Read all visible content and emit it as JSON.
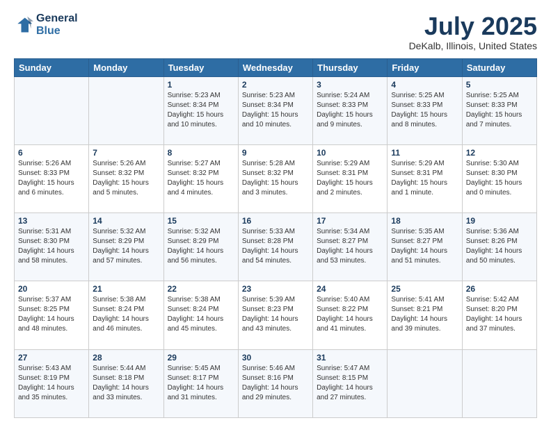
{
  "logo": {
    "line1": "General",
    "line2": "Blue"
  },
  "title": "July 2025",
  "subtitle": "DeKalb, Illinois, United States",
  "days_header": [
    "Sunday",
    "Monday",
    "Tuesday",
    "Wednesday",
    "Thursday",
    "Friday",
    "Saturday"
  ],
  "weeks": [
    [
      {
        "day": "",
        "info": ""
      },
      {
        "day": "",
        "info": ""
      },
      {
        "day": "1",
        "info": "Sunrise: 5:23 AM\nSunset: 8:34 PM\nDaylight: 15 hours and 10 minutes."
      },
      {
        "day": "2",
        "info": "Sunrise: 5:23 AM\nSunset: 8:34 PM\nDaylight: 15 hours and 10 minutes."
      },
      {
        "day": "3",
        "info": "Sunrise: 5:24 AM\nSunset: 8:33 PM\nDaylight: 15 hours and 9 minutes."
      },
      {
        "day": "4",
        "info": "Sunrise: 5:25 AM\nSunset: 8:33 PM\nDaylight: 15 hours and 8 minutes."
      },
      {
        "day": "5",
        "info": "Sunrise: 5:25 AM\nSunset: 8:33 PM\nDaylight: 15 hours and 7 minutes."
      }
    ],
    [
      {
        "day": "6",
        "info": "Sunrise: 5:26 AM\nSunset: 8:33 PM\nDaylight: 15 hours and 6 minutes."
      },
      {
        "day": "7",
        "info": "Sunrise: 5:26 AM\nSunset: 8:32 PM\nDaylight: 15 hours and 5 minutes."
      },
      {
        "day": "8",
        "info": "Sunrise: 5:27 AM\nSunset: 8:32 PM\nDaylight: 15 hours and 4 minutes."
      },
      {
        "day": "9",
        "info": "Sunrise: 5:28 AM\nSunset: 8:32 PM\nDaylight: 15 hours and 3 minutes."
      },
      {
        "day": "10",
        "info": "Sunrise: 5:29 AM\nSunset: 8:31 PM\nDaylight: 15 hours and 2 minutes."
      },
      {
        "day": "11",
        "info": "Sunrise: 5:29 AM\nSunset: 8:31 PM\nDaylight: 15 hours and 1 minute."
      },
      {
        "day": "12",
        "info": "Sunrise: 5:30 AM\nSunset: 8:30 PM\nDaylight: 15 hours and 0 minutes."
      }
    ],
    [
      {
        "day": "13",
        "info": "Sunrise: 5:31 AM\nSunset: 8:30 PM\nDaylight: 14 hours and 58 minutes."
      },
      {
        "day": "14",
        "info": "Sunrise: 5:32 AM\nSunset: 8:29 PM\nDaylight: 14 hours and 57 minutes."
      },
      {
        "day": "15",
        "info": "Sunrise: 5:32 AM\nSunset: 8:29 PM\nDaylight: 14 hours and 56 minutes."
      },
      {
        "day": "16",
        "info": "Sunrise: 5:33 AM\nSunset: 8:28 PM\nDaylight: 14 hours and 54 minutes."
      },
      {
        "day": "17",
        "info": "Sunrise: 5:34 AM\nSunset: 8:27 PM\nDaylight: 14 hours and 53 minutes."
      },
      {
        "day": "18",
        "info": "Sunrise: 5:35 AM\nSunset: 8:27 PM\nDaylight: 14 hours and 51 minutes."
      },
      {
        "day": "19",
        "info": "Sunrise: 5:36 AM\nSunset: 8:26 PM\nDaylight: 14 hours and 50 minutes."
      }
    ],
    [
      {
        "day": "20",
        "info": "Sunrise: 5:37 AM\nSunset: 8:25 PM\nDaylight: 14 hours and 48 minutes."
      },
      {
        "day": "21",
        "info": "Sunrise: 5:38 AM\nSunset: 8:24 PM\nDaylight: 14 hours and 46 minutes."
      },
      {
        "day": "22",
        "info": "Sunrise: 5:38 AM\nSunset: 8:24 PM\nDaylight: 14 hours and 45 minutes."
      },
      {
        "day": "23",
        "info": "Sunrise: 5:39 AM\nSunset: 8:23 PM\nDaylight: 14 hours and 43 minutes."
      },
      {
        "day": "24",
        "info": "Sunrise: 5:40 AM\nSunset: 8:22 PM\nDaylight: 14 hours and 41 minutes."
      },
      {
        "day": "25",
        "info": "Sunrise: 5:41 AM\nSunset: 8:21 PM\nDaylight: 14 hours and 39 minutes."
      },
      {
        "day": "26",
        "info": "Sunrise: 5:42 AM\nSunset: 8:20 PM\nDaylight: 14 hours and 37 minutes."
      }
    ],
    [
      {
        "day": "27",
        "info": "Sunrise: 5:43 AM\nSunset: 8:19 PM\nDaylight: 14 hours and 35 minutes."
      },
      {
        "day": "28",
        "info": "Sunrise: 5:44 AM\nSunset: 8:18 PM\nDaylight: 14 hours and 33 minutes."
      },
      {
        "day": "29",
        "info": "Sunrise: 5:45 AM\nSunset: 8:17 PM\nDaylight: 14 hours and 31 minutes."
      },
      {
        "day": "30",
        "info": "Sunrise: 5:46 AM\nSunset: 8:16 PM\nDaylight: 14 hours and 29 minutes."
      },
      {
        "day": "31",
        "info": "Sunrise: 5:47 AM\nSunset: 8:15 PM\nDaylight: 14 hours and 27 minutes."
      },
      {
        "day": "",
        "info": ""
      },
      {
        "day": "",
        "info": ""
      }
    ]
  ]
}
